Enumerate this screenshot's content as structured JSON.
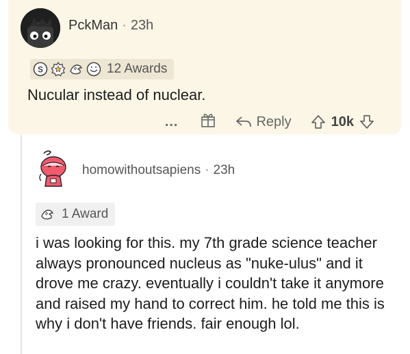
{
  "top_comment": {
    "username": "PckMan",
    "time": "23h",
    "awards_label": "12 Awards",
    "body": "Nucular instead of nuclear.",
    "actions": {
      "more": "...",
      "reply": "Reply",
      "score": "10k"
    }
  },
  "reply_comment": {
    "username": "homowithoutsapiens",
    "time": "23h",
    "awards_label": "1 Award",
    "body": "i was looking for this. my 7th grade science teacher always pronounced nucleus as \"nuke-ulus\" and it drove me crazy. eventually i couldn't take it anymore and raised my hand to correct him. he told me this is why i don't have friends. fair enough lol."
  },
  "icons": [
    "avatar-icon",
    "silver-award-icon",
    "gold-award-icon",
    "hand-award-icon",
    "smile-award-icon",
    "gift-icon",
    "reply-icon",
    "upvote-icon",
    "downvote-icon"
  ],
  "colors": {
    "top_comment_bg": "#fbf6e6",
    "award_pill_bg": "#ece6d3",
    "text": "#1c1c1c",
    "muted": "#666666"
  }
}
